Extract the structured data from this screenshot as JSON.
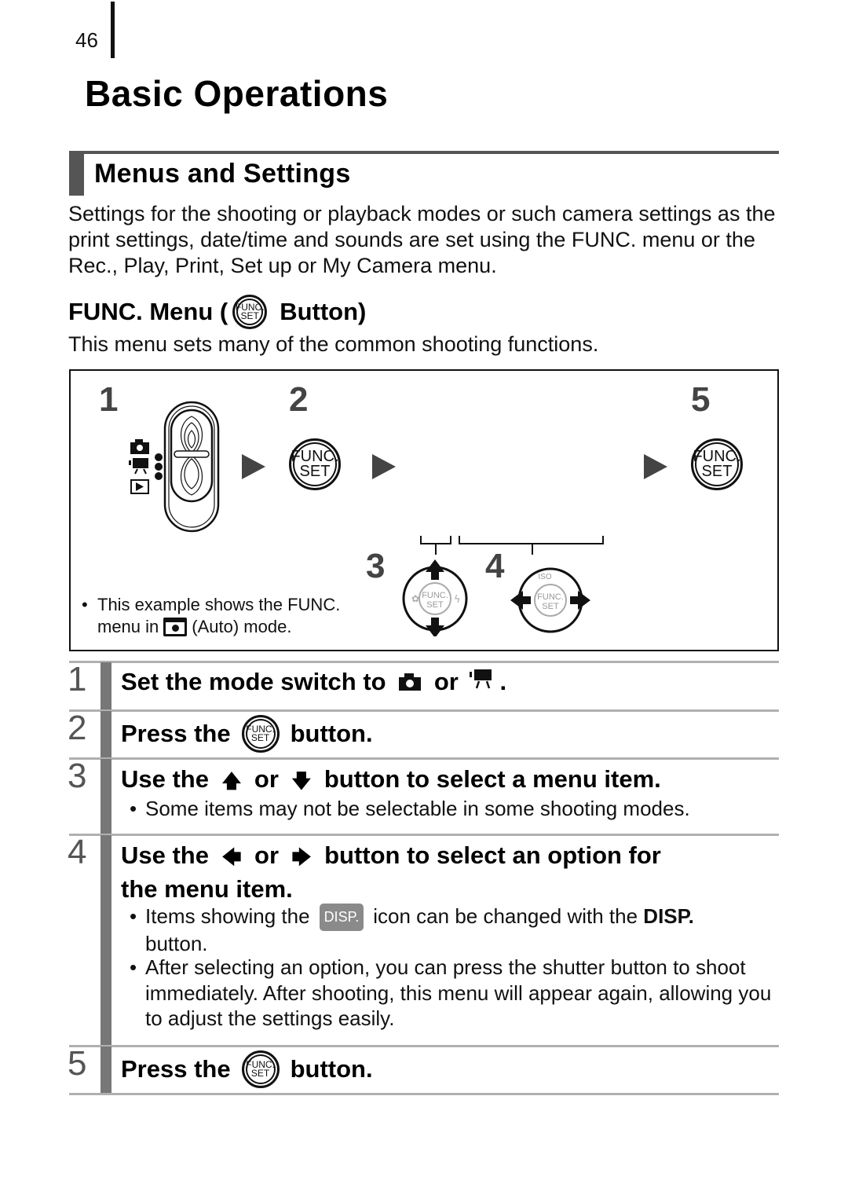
{
  "page": {
    "number": "46",
    "title": "Basic Operations"
  },
  "section": {
    "title": "Menus and Settings",
    "intro": "Settings for the shooting or playback modes or such camera settings as the print settings, date/time and sounds are set using the FUNC. menu or the Rec., Play, Print, Set up or My Camera menu."
  },
  "func_menu": {
    "heading_before": "FUNC. Menu (",
    "heading_after": "Button)",
    "description": "This menu sets many of the common shooting functions.",
    "button_label_top": "FUNC.",
    "button_label_bottom": "SET"
  },
  "diagram": {
    "step_labels": [
      "1",
      "2",
      "3",
      "4",
      "5"
    ],
    "note_line1": "This example shows the FUNC.",
    "note_line2_before": "menu in",
    "note_line2_after": "(Auto) mode.",
    "bullet": "•",
    "dpad_center_top": "FUNC.",
    "dpad_center_bottom": "SET",
    "dpad4_top_label": "ISO"
  },
  "steps": [
    {
      "num": "1",
      "text_before": "Set the mode switch to",
      "text_mid": "or",
      "text_after": "."
    },
    {
      "num": "2",
      "text_before": "Press the",
      "text_after": "button."
    },
    {
      "num": "3",
      "text_before": "Use the",
      "arrow1": "🡅",
      "text_mid": "or",
      "arrow2": "🡇",
      "text_after": "button to select a menu item.",
      "bullets": [
        "Some items may not be selectable in some shooting modes."
      ]
    },
    {
      "num": "4",
      "line1_before": "Use the",
      "arrow1": "🡄",
      "line1_mid": "or",
      "arrow2": "🡆",
      "line1_after": "button to select an option for",
      "line2": "the menu item.",
      "bullet1_before": "Items showing the",
      "disp_icon": "DISP.",
      "bullet1_after": "icon can be changed with the",
      "bullet1_bold": "DISP.",
      "bullet1_end": "button.",
      "bullet2": "After selecting an option, you can press the shutter button to shoot immediately. After shooting, this menu will appear again, allowing you to adjust the settings easily."
    },
    {
      "num": "5",
      "text_before": "Press the",
      "text_after": "button."
    }
  ],
  "bullet_char": "•"
}
